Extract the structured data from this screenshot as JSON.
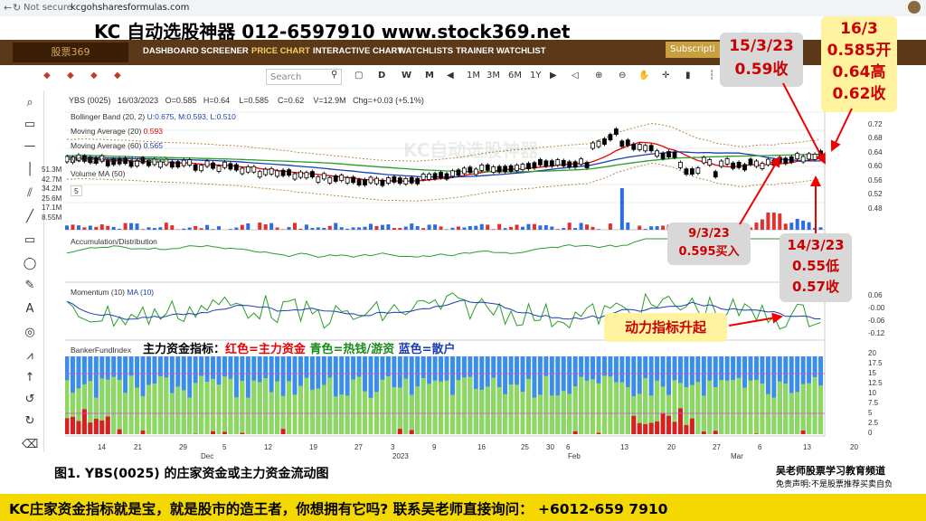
{
  "browser": {
    "not_secure": "Not secure",
    "url": "kcgohsharesformulas.com"
  },
  "banner": {
    "title": "KC 自动选股神器 012-6597910  www.stock369.net"
  },
  "site": {
    "logo": "股票369",
    "nav": [
      "DASHBOARD",
      "SCREENER",
      "PRICE CHART",
      "INTERACTIVE CHART",
      "WATCHLISTS",
      "TRAINER WATCHLIST"
    ],
    "subscribe": "Subscripti"
  },
  "toolbar": {
    "search_placeholder": "Search",
    "periods": [
      "1M",
      "3M",
      "6M",
      "1Y"
    ],
    "letters": [
      "D",
      "W",
      "M"
    ]
  },
  "quote": {
    "symbol": "YBS (0025)",
    "date": "16/03/2023",
    "open": "O=0.585",
    "high": "H=0.64",
    "low": "L=0.585",
    "close": "C=0.62",
    "volume": "V=12.9M",
    "change": "Chg=+0.03 (+5.1%)"
  },
  "indicators": {
    "bb": "Bollinger Band (20, 2)",
    "bb_vals": "U:0.675,  M:0.593,  L:0.510",
    "ma20": "Moving Average (20)",
    "ma20_val": "0.593",
    "ma60": "Moving Average (60)",
    "ma60_val": "0.565",
    "ma120": "Moving Average (120)",
    "ma120_val": "0.603",
    "volma": "Volume MA (50)",
    "ad": "Accumulation/Distribution",
    "mom": "Momentum (10)",
    "mom_ma": "MA (10)",
    "banker": "BankerFundIndex",
    "collapse": "5"
  },
  "annotations": {
    "fund_label": "主力资金指标：",
    "red": "红色=主力资金",
    "green": "青色=热钱/游资",
    "blue": "蓝色=散户",
    "c_1503_a": "15/3/23",
    "c_1503_b": "0.59收",
    "c_1603_a": "16/3",
    "c_1603_b": "0.585开",
    "c_1603_c": "0.64高",
    "c_1603_d": "0.62收",
    "c_0903_a": "9/3/23",
    "c_0903_b": "0.595买入",
    "c_1403_a": "14/3/23",
    "c_1403_b": "0.55低",
    "c_1403_c": "0.57收",
    "momentum_up": "动力指标升起"
  },
  "axes": {
    "price": [
      "0.76",
      "0.72",
      "0.68",
      "0.64",
      "0.60",
      "0.56",
      "0.52",
      "0.48"
    ],
    "vol": [
      "51.3M",
      "42.7M",
      "34.2M",
      "25.6M",
      "17.1M",
      "8.55M"
    ],
    "mom": [
      "0.06",
      "-0.00",
      "-0.06",
      "-0.12"
    ],
    "banker": [
      "20",
      "17.5",
      "15",
      "12.5",
      "10",
      "7.5",
      "5",
      "2.5",
      "0"
    ],
    "dates": [
      "14",
      "21",
      "29",
      "Dec",
      "5",
      "12",
      "19",
      "27",
      "3",
      "2023",
      "9",
      "16",
      "25",
      "30",
      "6",
      "Feb",
      "13",
      "20",
      "27",
      "Mar",
      "6",
      "13",
      "20"
    ]
  },
  "bottom": {
    "caption": "图1. YBS(0025) 的庄家资金或主力资金流动图",
    "teacher": "吴老师股票学习教育频道",
    "disclaimer": "免责声明:不是股票推荐买卖自负",
    "footer": "KC庄家资金指标就是宝，就是股市的造王者，你想拥有它吗? 联系吴老师直接询问： +6012-659 7910"
  },
  "colors": {
    "accent": "#f5d800",
    "nav": "#5a3818",
    "red": "#e00000",
    "green": "#2a9d2a",
    "blue": "#2040c0"
  }
}
